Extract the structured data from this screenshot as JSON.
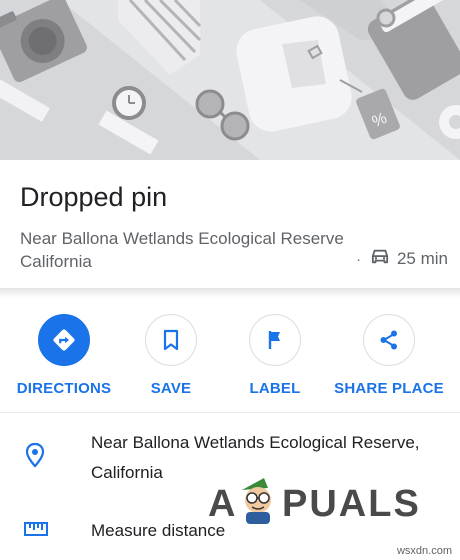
{
  "place": {
    "title": "Dropped pin",
    "subtitle": "Near Ballona Wetlands Ecological Reserve California",
    "drive_separator": "·",
    "drive_time": "25 min",
    "drive_icon": "car-icon"
  },
  "actions": [
    {
      "label": "DIRECTIONS",
      "icon": "directions-icon"
    },
    {
      "label": "SAVE",
      "icon": "bookmark-icon"
    },
    {
      "label": "LABEL",
      "icon": "flag-icon"
    },
    {
      "label": "SHARE PLACE",
      "icon": "share-icon"
    }
  ],
  "details": [
    {
      "text": "Near Ballona Wetlands Ecological Reserve, California",
      "icon": "location-pin-icon"
    },
    {
      "text": "Measure distance",
      "icon": "ruler-icon"
    }
  ],
  "watermark": {
    "text": "APPUALS"
  },
  "source": "wsxdn.com",
  "colors": {
    "accent": "#1a73e8",
    "hero_background": "#d6d7db",
    "secondary_text": "#5f6368",
    "primary_text": "#202124"
  }
}
